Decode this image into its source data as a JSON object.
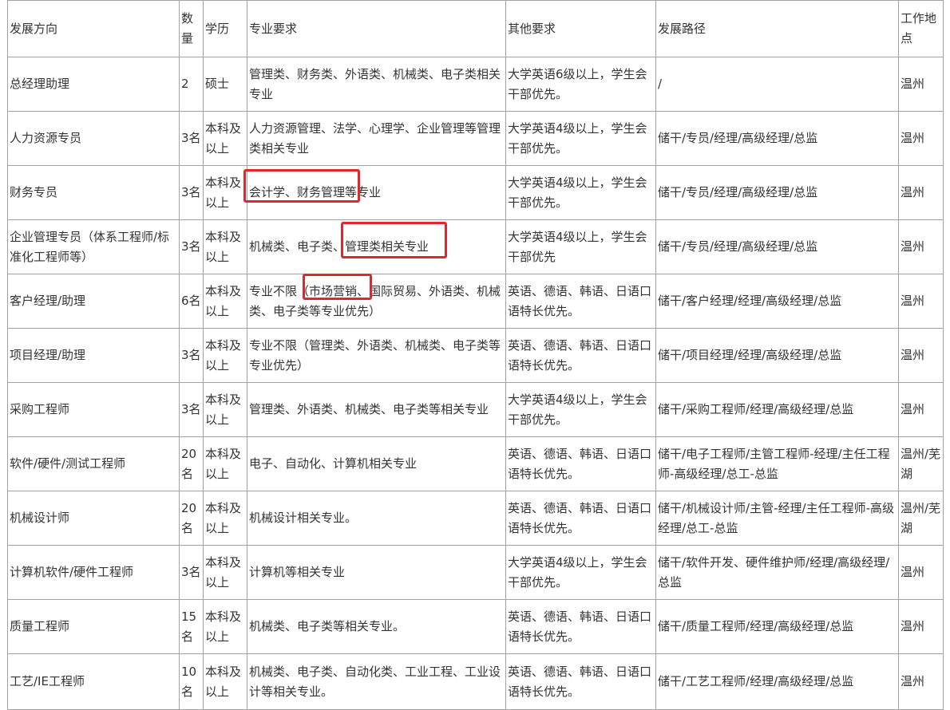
{
  "headers": [
    "发展方向",
    "数量",
    "学历",
    "专业要求",
    "其他要求",
    "发展路径",
    "工作地点"
  ],
  "rows": [
    [
      "总经理助理",
      "2",
      "硕士",
      "管理类、财务类、外语类、机械类、电子类相关专业",
      "大学英语6级以上，学生会干部优先。",
      "/",
      "温州"
    ],
    [
      "人力资源专员",
      "3名",
      "本科及以上",
      "人力资源管理、法学、心理学、企业管理等管理类相关专业",
      "大学英语4级以上，学生会干部优先。",
      "储干/专员/经理/高级经理/总监",
      "温州"
    ],
    [
      "财务专员",
      "3名",
      "本科及以上",
      "会计学、财务管理等专业",
      "大学英语4级以上，学生会干部优先。",
      "储干/专员/经理/高级经理/总监",
      "温州"
    ],
    [
      "企业管理专员（体系工程师/标准化工程师等）",
      "3名",
      "本科及以上",
      "机械类、电子类、管理类相关专业",
      "大学英语4级以上，学生会干部优先",
      "储干/专员/经理/高级经理/总监",
      "温州"
    ],
    [
      "客户经理/助理",
      "6名",
      "本科及以上",
      "专业不限（市场营销、国际贸易、外语类、机械类、电子类等专业优先）",
      "英语、德语、韩语、日语口语特长优先。",
      "储干/客户经理/经理/高级经理/总监",
      "温州"
    ],
    [
      "项目经理/助理",
      "3名",
      "本科及以上",
      "专业不限（管理类、外语类、机械类、电子类等专业优先）",
      "英语、德语、韩语、日语口语特长优先。",
      "储干/项目经理/经理/高级经理/总监",
      "温州"
    ],
    [
      "采购工程师",
      "3名",
      "本科及以上",
      "管理类、外语类、机械类、电子类等相关专业",
      "大学英语4级以上，学生会干部优先。",
      "储干/采购工程师/经理/高级经理/总监",
      "温州"
    ],
    [
      "软件/硬件/测试工程师",
      "20名",
      "本科及以上",
      "电子、自动化、计算机相关专业",
      "英语、德语、韩语、日语口语特长优先。",
      "储干/电子工程师/主管工程师-经理/主任工程师-高级经理/总工-总监",
      "温州/芜湖"
    ],
    [
      "机械设计师",
      "20名",
      "本科及以上",
      "机械设计相关专业。",
      "英语、德语、韩语、日语口语特长优先。",
      "储干/机械设计师/主管-经理/主任工程师-高级经理/总工-总监",
      "温州/芜湖"
    ],
    [
      "计算机软件/硬件工程师",
      "3名",
      "本科及以上",
      "计算机等相关专业",
      "大学英语4级以上，学生会干部优先。",
      "储干/软件开发、硬件维护师/经理/高级经理/总监",
      "温州"
    ],
    [
      "质量工程师",
      "15名",
      "本科及以上",
      "机械类、电子类等相关专业。",
      "英语、德语、韩语、日语口语特长优先。",
      "储干/质量工程师/经理/高级经理/总监",
      "温州"
    ],
    [
      "工艺/IE工程师",
      "10名",
      "本科及以上",
      "机械类、电子类、自动化类、工业工程、工业设计等相关专业。",
      "英语、德语、韩语、日语口语特长优先。",
      "储干/工艺工程师/经理/高级经理/总监",
      "温州"
    ]
  ],
  "highlight_color": "#e0282c"
}
